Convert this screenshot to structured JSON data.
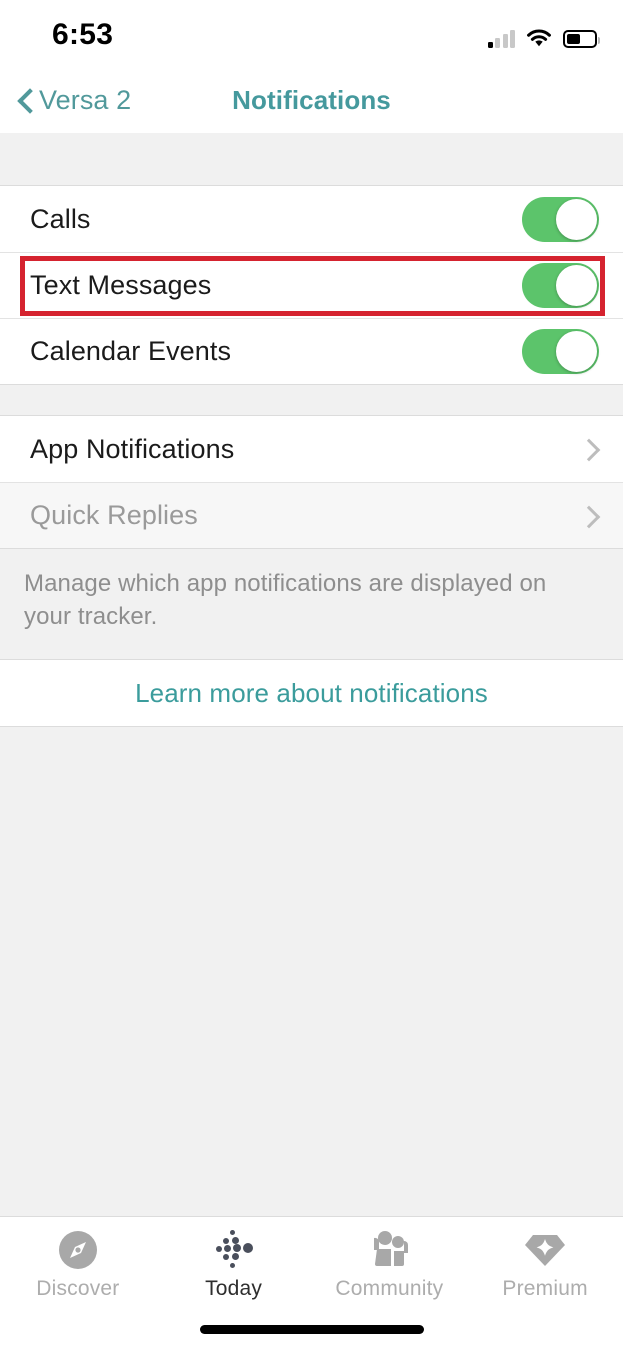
{
  "status_bar": {
    "time": "6:53",
    "signal_icon": "cellular-signal-icon",
    "signal_bars_filled": 1,
    "signal_bars_total": 4,
    "wifi_icon": "wifi-icon",
    "battery_icon": "battery-icon",
    "battery_level_percent": 43
  },
  "nav": {
    "back_label": "Versa 2",
    "back_icon": "chevron-left-icon",
    "title": "Notifications",
    "accent_color": "#45999d"
  },
  "toggles": [
    {
      "label": "Calls",
      "on": true
    },
    {
      "label": "Text Messages",
      "on": true
    },
    {
      "label": "Calendar Events",
      "on": true
    }
  ],
  "nav_rows": [
    {
      "label": "App Notifications",
      "disabled": false,
      "chevron": "chevron-right-icon"
    },
    {
      "label": "Quick Replies",
      "disabled": true,
      "chevron": "chevron-right-icon"
    }
  ],
  "helper_text": "Manage which app notifications are displayed on your tracker.",
  "learn_more": "Learn more about notifications",
  "highlight": {
    "target": "Text Messages",
    "color": "#d5232f"
  },
  "toggle_on_color": "#5cc46b",
  "tabs": [
    {
      "label": "Discover",
      "icon": "compass-icon",
      "active": false
    },
    {
      "label": "Today",
      "icon": "fitbit-dots-icon",
      "active": true
    },
    {
      "label": "Community",
      "icon": "people-icon",
      "active": false
    },
    {
      "label": "Premium",
      "icon": "gem-icon",
      "active": false
    }
  ],
  "home_indicator": "home-indicator-bar"
}
